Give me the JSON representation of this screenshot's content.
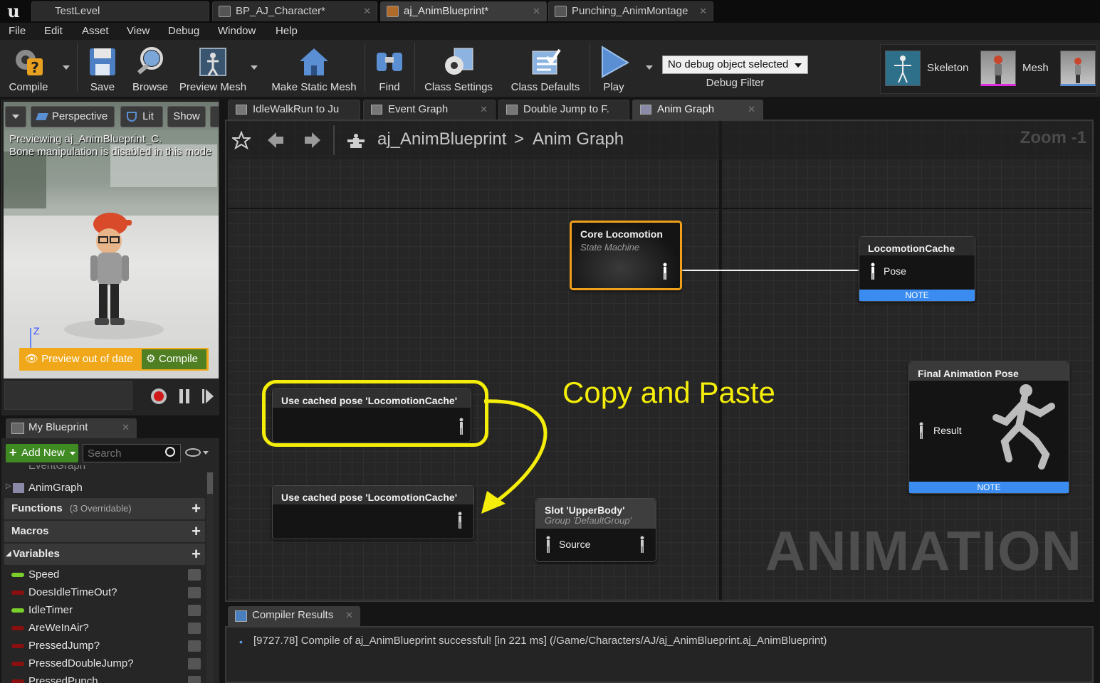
{
  "tabs": [
    {
      "label": "TestLevel"
    },
    {
      "label": "BP_AJ_Character*"
    },
    {
      "label": "aj_AnimBlueprint*"
    },
    {
      "label": "Punching_AnimMontage"
    }
  ],
  "menu": [
    "File",
    "Edit",
    "Asset",
    "View",
    "Debug",
    "Window",
    "Help"
  ],
  "toolbar": {
    "compile": "Compile",
    "save": "Save",
    "browse": "Browse",
    "preview_mesh": "Preview Mesh",
    "make_static_mesh": "Make Static Mesh",
    "find": "Find",
    "class_settings": "Class Settings",
    "class_defaults": "Class Defaults",
    "play": "Play",
    "debug_select": "No debug object selected",
    "debug_filter": "Debug Filter",
    "skeleton": "Skeleton",
    "mesh": "Mesh"
  },
  "viewport": {
    "perspective": "Perspective",
    "lit": "Lit",
    "show": "Show",
    "line1": "Previewing aj_AnimBlueprint_C.",
    "line2": "Bone manipulation is disabled in this mode",
    "axis": "Z",
    "preview_out_of_date": "Preview out of date",
    "compile": "Compile"
  },
  "my_blueprint": {
    "tab": "My Blueprint",
    "add_new": "Add New",
    "search_placeholder": "Search",
    "event_graph": "EventGraph",
    "anim_graph": "AnimGraph",
    "functions": "Functions",
    "functions_note": "(3 Overridable)",
    "macros": "Macros",
    "variables": "Variables",
    "vars": [
      {
        "name": "Speed",
        "color": "#7ad02a"
      },
      {
        "name": "DoesIdleTimeOut?",
        "color": "#8a0f0f"
      },
      {
        "name": "IdleTimer",
        "color": "#7ad02a"
      },
      {
        "name": "AreWeInAir?",
        "color": "#8a0f0f"
      },
      {
        "name": "PressedJump?",
        "color": "#8a0f0f"
      },
      {
        "name": "PressedDoubleJump?",
        "color": "#8a0f0f"
      },
      {
        "name": "PressedPunch",
        "color": "#8a0f0f"
      }
    ]
  },
  "graph_tabs": [
    {
      "label": "IdleWalkRun to Ju"
    },
    {
      "label": "Event Graph"
    },
    {
      "label": "Double Jump to F."
    },
    {
      "label": "Anim Graph"
    }
  ],
  "graph": {
    "crumb_root": "aj_AnimBlueprint",
    "crumb_sep": ">",
    "crumb_current": "Anim Graph",
    "zoom": "Zoom -1",
    "watermark": "ANIMATION",
    "annotation": "Copy and Paste",
    "nodes": {
      "core": {
        "title": "Core Locomotion",
        "subtitle": "State Machine"
      },
      "cache": {
        "title": "LocomotionCache",
        "pin": "Pose",
        "note": "NOTE"
      },
      "final": {
        "title": "Final Animation Pose",
        "pin": "Result",
        "note": "NOTE"
      },
      "use1": {
        "title": "Use cached pose 'LocomotionCache'"
      },
      "use2": {
        "title": "Use cached pose 'LocomotionCache'"
      },
      "slot": {
        "title": "Slot 'UpperBody'",
        "subtitle": "Group 'DefaultGroup'",
        "pin": "Source"
      }
    }
  },
  "compiler": {
    "tab": "Compiler Results",
    "message": "[9727.78] Compile of aj_AnimBlueprint successful! [in 221 ms] (/Game/Characters/AJ/aj_AnimBlueprint.aj_AnimBlueprint)"
  }
}
